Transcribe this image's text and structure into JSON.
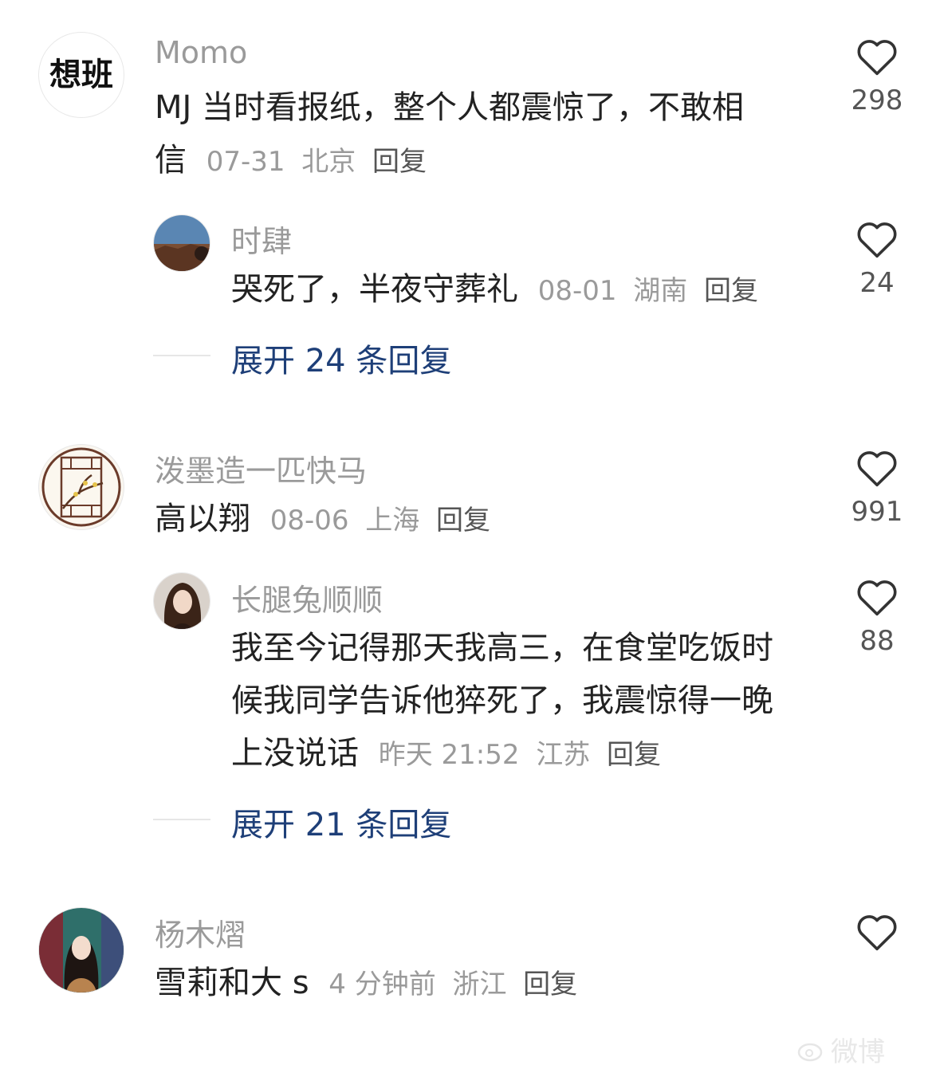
{
  "comments": [
    {
      "username": "Momo",
      "avatar_text": "想班",
      "text": "MJ 当时看报纸，整个人都震惊了，不敢相",
      "text_cont": "信",
      "date": "07-31",
      "location": "北京",
      "reply": "回复",
      "likes": "298",
      "replies": [
        {
          "username": "时肆",
          "text": "哭死了，半夜守葬礼",
          "date": "08-01",
          "location": "湖南",
          "reply": "回复",
          "likes": "24"
        }
      ],
      "expand": "展开 24 条回复"
    },
    {
      "username": "泼墨造一匹快马",
      "text": "高以翔",
      "date": "08-06",
      "location": "上海",
      "reply": "回复",
      "likes": "991",
      "replies": [
        {
          "username": "长腿兔顺顺",
          "lines": [
            "我至今记得那天我高三，在食堂吃饭时",
            "候我同学告诉他猝死了，我震惊得一晚",
            "上没说话"
          ],
          "date": "昨天 21:52",
          "location": "江苏",
          "reply": "回复",
          "likes": "88"
        }
      ],
      "expand": "展开 21 条回复"
    },
    {
      "username": "杨木熠",
      "text": "雪莉和大 s",
      "date": "4 分钟前",
      "location": "浙江",
      "reply": "回复"
    }
  ],
  "watermark": "微博"
}
